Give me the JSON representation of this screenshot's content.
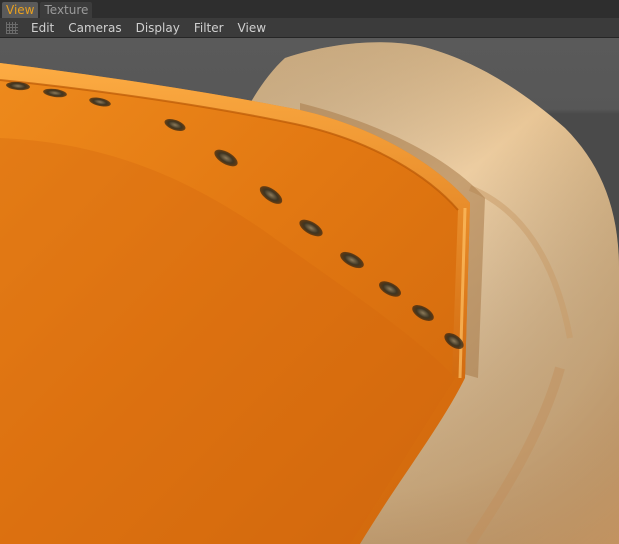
{
  "tabs": [
    {
      "label": "View",
      "active": true
    },
    {
      "label": "Texture",
      "active": false
    }
  ],
  "menu": [
    "Edit",
    "Cameras",
    "Display",
    "Filter",
    "View"
  ],
  "icons": {
    "menu_grip": "grip-icon"
  },
  "colors": {
    "accent": "#e8a020",
    "viewport_bg": "#4c4c4c",
    "cloth": "#e9c79a",
    "leather": "#e47a12"
  }
}
